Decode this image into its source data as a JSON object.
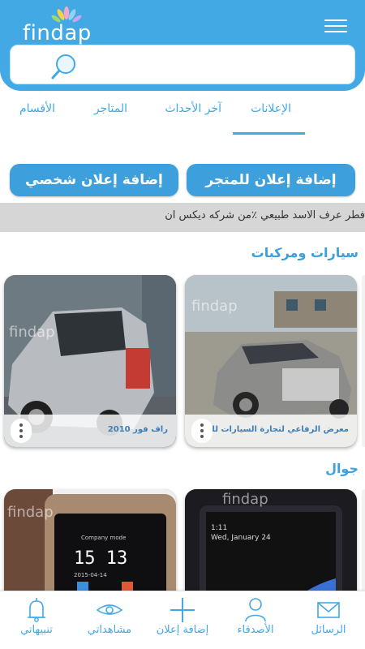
{
  "app": {
    "logo_text": "findap"
  },
  "search": {
    "placeholder": ""
  },
  "tabs": [
    {
      "label": "الإعلانات",
      "active": true
    },
    {
      "label": "آخر الأحداث",
      "active": false
    },
    {
      "label": "المتاجر",
      "active": false
    },
    {
      "label": "الأقسام",
      "active": false
    }
  ],
  "actions": {
    "store_ad": "إضافة إعلان للمتجر",
    "personal_ad": "إضافة إعلان شخصي"
  },
  "ticker": {
    "text": "فطر عرف الاسد طبيعي ٪من شركه ديكس ان"
  },
  "sections": [
    {
      "title": "سيارات ومركبات",
      "cards": [
        {
          "title": "معرض الرفاعي لتجارة السيارات للبيع",
          "icon": "white-suv-photo"
        },
        {
          "title": "راف فور 2010",
          "icon": "silver-suv-photo"
        }
      ]
    },
    {
      "title": "جوال",
      "cards": [
        {
          "title": "",
          "icon": "smartphone-photo",
          "screen_date": "Wed, January 24",
          "screen_time": "1:11"
        },
        {
          "title": "",
          "icon": "smartwatch-photo",
          "screen_mode": "Company mode",
          "screen_time": "15 13",
          "screen_date": "2015-04-14"
        }
      ]
    }
  ],
  "bottom_nav": [
    {
      "label": "الرسائل",
      "icon": "envelope-icon"
    },
    {
      "label": "الأصدقاء",
      "icon": "person-icon"
    },
    {
      "label": "إضافة إعلان",
      "icon": "plus-icon"
    },
    {
      "label": "مشاهداتي",
      "icon": "eye-icon"
    },
    {
      "label": "تنبيهاتي",
      "icon": "bell-icon"
    }
  ],
  "colors": {
    "brand": "#42a9e4",
    "button": "#3d9fdc",
    "ticker_bg": "#d6d6d6"
  }
}
